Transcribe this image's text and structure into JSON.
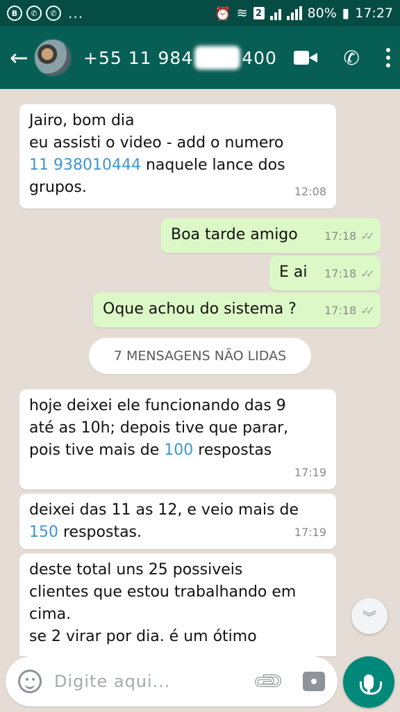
{
  "status_bar": {
    "left_icons": [
      "B",
      "whatsapp-icon",
      "whatsapp-icon"
    ],
    "more": "...",
    "sim_badge": "2",
    "battery": "80%",
    "time": "17:27"
  },
  "header": {
    "phone_prefix": "+55 11 984",
    "phone_suffix": "400"
  },
  "messages": [
    {
      "lines": [
        "Jairo, bom dia",
        "eu assisti o video - add o numero",
        "naquele lance dos",
        "grupos."
      ],
      "link": "11 938010444",
      "time": "12:08"
    },
    {
      "text": "Boa tarde amigo",
      "time": "17:18"
    },
    {
      "text": "E ai",
      "time": "17:18"
    },
    {
      "text": "Oque achou do sistema ?",
      "time": "17:18"
    },
    {
      "lines": [
        "hoje deixei ele funcionando das 9",
        "até as 10h; depois tive que parar,",
        "pois tive mais de ",
        " respostas"
      ],
      "link": "100",
      "time": "17:19"
    },
    {
      "lines": [
        "deixei das 11 as 12, e veio mais de",
        " respostas."
      ],
      "link": "150",
      "time": "17:19"
    },
    {
      "lines": [
        "deste total uns 25 possiveis",
        "clientes que estou trabalhando em",
        "cima.",
        "se 2 virar por dia. é um ótimo"
      ]
    }
  ],
  "unread_banner": "7 MENSAGENS NÃO LIDAS",
  "input": {
    "placeholder": "Digite aqui..."
  },
  "colors": {
    "header": "#075e54",
    "status_bar": "#054d44",
    "outgoing": "#dcf8c6",
    "incoming": "#ffffff",
    "link": "#3b97d3",
    "mic": "#00897b"
  }
}
